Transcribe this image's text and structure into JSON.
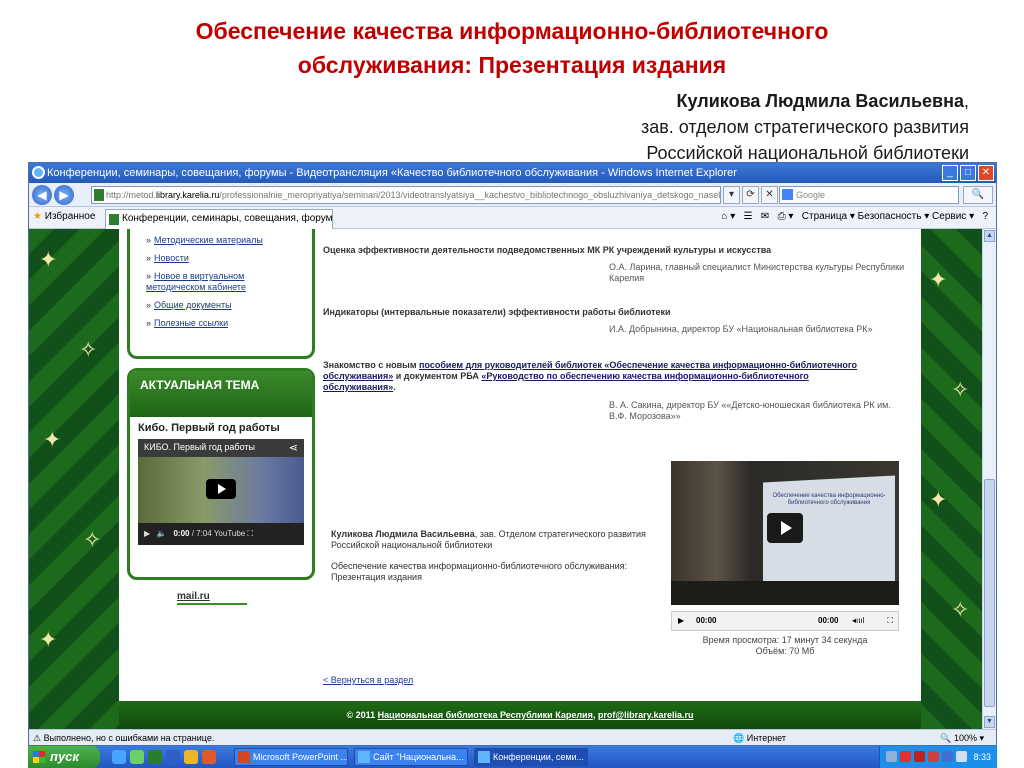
{
  "slide": {
    "title_line1": "Обеспечение качества информационно-библиотечного",
    "title_line2": "обслуживания: Презентация издания",
    "author_name": "Куликова Людмила Васильевна",
    "author_comma": ",",
    "author_role1": "зав. отделом стратегического развития",
    "author_role2": "Российской национальной библиотеки"
  },
  "browser": {
    "window_title": "Конференции, семинары, совещания, форумы - Видеотрансляция «Качество библиотечного обслуживания - Windows Internet Explorer",
    "url_prefix": "http://metod.",
    "url_domain": "library.karelia.ru",
    "url_path": "/professionalnie_meropriyatiya/seminari/2013/videotranslyatsiya__kachestvo_bibliotechnogo_obsluzhivaniya_detskogo_naseleni",
    "search_placeholder": "Google",
    "favorites_label": "Избранное",
    "tab_label": "Конференции, семинары, совещания, форумы - Ви...",
    "tools": "Страница ▾   Безопасность ▾   Сервис ▾",
    "status_text": "Выполнено, но с ошибками на странице.",
    "status_zone": "Интернет",
    "status_zoom": "100%"
  },
  "sidebar": {
    "items": [
      {
        "label": "Методические материалы"
      },
      {
        "label": "Новости"
      },
      {
        "label": "Новое в виртуальном методическом кабинете"
      },
      {
        "label": "Общие документы"
      },
      {
        "label": "Полезные ссылки"
      }
    ],
    "bullet": "»",
    "topic_heading": "АКТУАЛЬНАЯ ТЕМА",
    "topic_title": "Кибо. Первый год работы",
    "mini_video_title": "КИБО. Первый год работы",
    "mini_video_time": "0:00",
    "mini_video_duration": "/ 7:04",
    "mini_video_brand": "YouTube",
    "mail_logo": "mail.ru"
  },
  "main": {
    "talks": [
      {
        "title": "Оценка эффективности деятельности подведомственных МК РК учреждений культуры и искусства",
        "author": "О.А. Ларина, главный специалист Министерства культуры Республики Карелия"
      },
      {
        "title": "Индикаторы (интервальные показатели) эффективности работы библиотеки",
        "author": "И.А. Добрынина, директор БУ «Национальная библиотека РК»"
      }
    ],
    "talk3_pre": "Знакомство с новым ",
    "talk3_link1": "пособием для руководителей библиотек «Обеспечение качества информационно-библиотечного обслуживания»",
    "talk3_mid": " и документом РБА ",
    "talk3_link2": "«Руководство по обеспечению качества информационно-библиотечного обслуживания»",
    "talk3_end": ".",
    "talk3_author": "В. А. Сакина, директор БУ ««Детско-юношеская библиотека РК им. В.Ф. Морозова»»",
    "featured_name": "Куликова Людмила Васильевна",
    "featured_role": ", зав. Отделом стратегического развития Российской национальной библиотеки",
    "featured_title": "Обеспечение качества информационно-библиотечного обслуживания: Презентация издания",
    "video_screen_text": "Обеспечение качества информационно-библиотечного обслуживания",
    "video_time_start": "00:00",
    "video_time_end": "00:00",
    "video_view_time": "Время просмотра: 17 минут 34 секунда",
    "video_size": "Объём: 70 Мб",
    "back_link": "< Вернуться в раздел",
    "footer_pre": "© 2011 ",
    "footer_link": "Национальная библиотека Республики Карелия",
    "footer_sep": ", ",
    "footer_email": "prof@library.karelia.ru"
  },
  "taskbar": {
    "start_label": "пуск",
    "tasks": [
      {
        "label": "Microsoft PowerPoint ..."
      },
      {
        "label": "Сайт \"Национальна..."
      },
      {
        "label": "Конференции, семи..."
      }
    ],
    "clock": "8:33"
  },
  "colors": {
    "title_red": "#c00000",
    "site_green": "#2e7d1f",
    "xp_blue": "#2455c0"
  }
}
